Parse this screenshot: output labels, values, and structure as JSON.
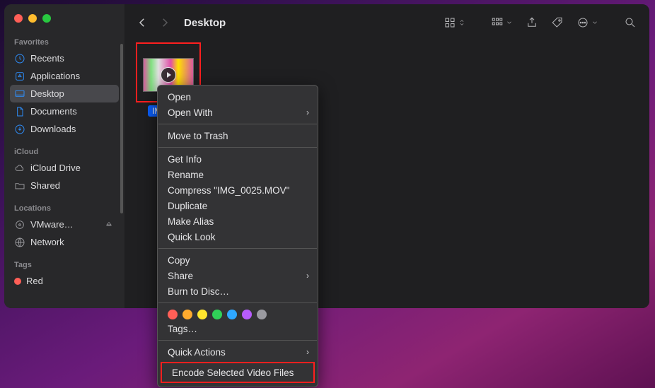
{
  "window": {
    "location_title": "Desktop"
  },
  "sidebar": {
    "sections": {
      "favorites": "Favorites",
      "icloud": "iCloud",
      "locations": "Locations",
      "tags": "Tags"
    },
    "favorites_items": [
      {
        "label": "Recents"
      },
      {
        "label": "Applications"
      },
      {
        "label": "Desktop"
      },
      {
        "label": "Documents"
      },
      {
        "label": "Downloads"
      }
    ],
    "icloud_items": [
      {
        "label": "iCloud Drive"
      },
      {
        "label": "Shared"
      }
    ],
    "locations_items": [
      {
        "label": "VMware…"
      },
      {
        "label": "Network"
      }
    ],
    "tags_items": [
      {
        "label": "Red",
        "color": "#ff5f57"
      }
    ]
  },
  "file": {
    "name": "IMG_0025.MOV",
    "display_label": "IMG_0..."
  },
  "context_menu": {
    "open": "Open",
    "open_with": "Open With",
    "move_to_trash": "Move to Trash",
    "get_info": "Get Info",
    "rename": "Rename",
    "compress": "Compress \"IMG_0025.MOV\"",
    "duplicate": "Duplicate",
    "make_alias": "Make Alias",
    "quick_look": "Quick Look",
    "copy": "Copy",
    "share": "Share",
    "burn": "Burn to Disc…",
    "tags": "Tags…",
    "quick_actions": "Quick Actions",
    "encode": "Encode Selected Video Files",
    "tag_colors": [
      "#ff5f57",
      "#ffab2e",
      "#ffe62e",
      "#30d158",
      "#2ea8ff",
      "#b75cff",
      "#9a9aa0"
    ]
  }
}
